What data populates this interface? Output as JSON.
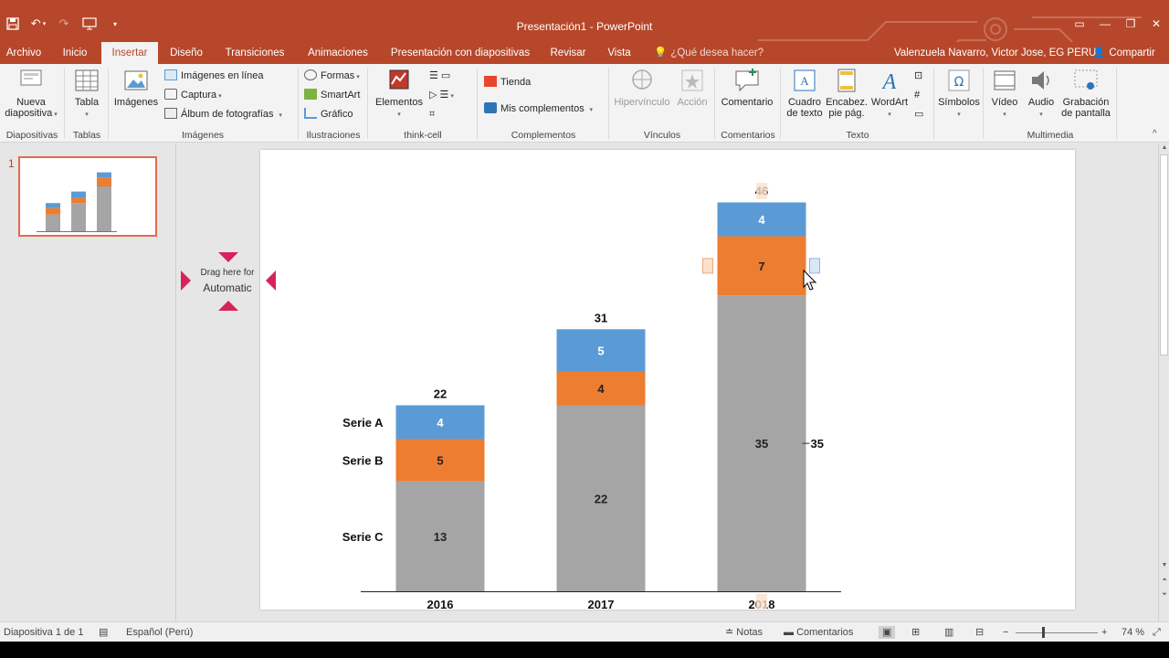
{
  "window": {
    "title": "Presentación1 - PowerPoint"
  },
  "menu": {
    "tabs": [
      "Archivo",
      "Inicio",
      "Insertar",
      "Diseño",
      "Transiciones",
      "Animaciones",
      "Presentación con diapositivas",
      "Revisar",
      "Vista"
    ],
    "active": "Insertar",
    "tell_me": "¿Qué desea hacer?",
    "user": "Valenzuela Navarro, Victor Jose, EG PERU",
    "share": "Compartir"
  },
  "ribbon": {
    "nueva": "Nueva",
    "diapositiva": "diapositiva",
    "tabla": "Tabla",
    "imagenes": "Imágenes",
    "imagenes_linea": "Imágenes en línea",
    "captura": "Captura",
    "album": "Álbum de fotografías",
    "formas": "Formas",
    "smartart": "SmartArt",
    "grafico": "Gráfico",
    "elementos": "Elementos",
    "tienda": "Tienda",
    "mis_complementos": "Mis complementos",
    "hipervinculo": "Hipervínculo",
    "accion": "Acción",
    "comentario": "Comentario",
    "cuadro": "Cuadro",
    "de_texto": "de texto",
    "encabez": "Encabez.",
    "pie_pag": "pie pág.",
    "wordart": "WordArt",
    "simbolos": "Símbolos",
    "video": "Vídeo",
    "audio": "Audio",
    "grabacion": "Grabación",
    "de_pantalla": "de pantalla",
    "groups": [
      "Diapositivas",
      "Tablas",
      "Imágenes",
      "Ilustraciones",
      "think-cell",
      "Complementos",
      "Vínculos",
      "Comentarios",
      "Texto",
      "Multimedia"
    ]
  },
  "slides_panel": {
    "number": "1"
  },
  "drag_target": {
    "line1": "Drag here for",
    "line2": "Automatic"
  },
  "chart_data": {
    "type": "bar",
    "stacked": true,
    "categories": [
      "2016",
      "2017",
      "2018"
    ],
    "series": [
      {
        "name": "Serie C",
        "values": [
          13,
          22,
          35
        ],
        "color": "#a5a5a5"
      },
      {
        "name": "Serie B",
        "values": [
          5,
          4,
          7
        ],
        "color": "#ed7d31"
      },
      {
        "name": "Serie A",
        "values": [
          4,
          5,
          4
        ],
        "color": "#5b9bd5"
      }
    ],
    "totals": [
      22,
      31,
      46
    ],
    "legend_placement": "left",
    "grid": false
  },
  "statusbar": {
    "slide": "Diapositiva 1 de 1",
    "language": "Español (Perú)",
    "notes": "Notas",
    "comments": "Comentarios",
    "zoom": "74 %"
  },
  "colors": {
    "accent": "#b7472a",
    "serie_a": "#5b9bd5",
    "serie_b": "#ed7d31",
    "serie_c": "#a5a5a5",
    "drag_arrow": "#d6245b"
  }
}
